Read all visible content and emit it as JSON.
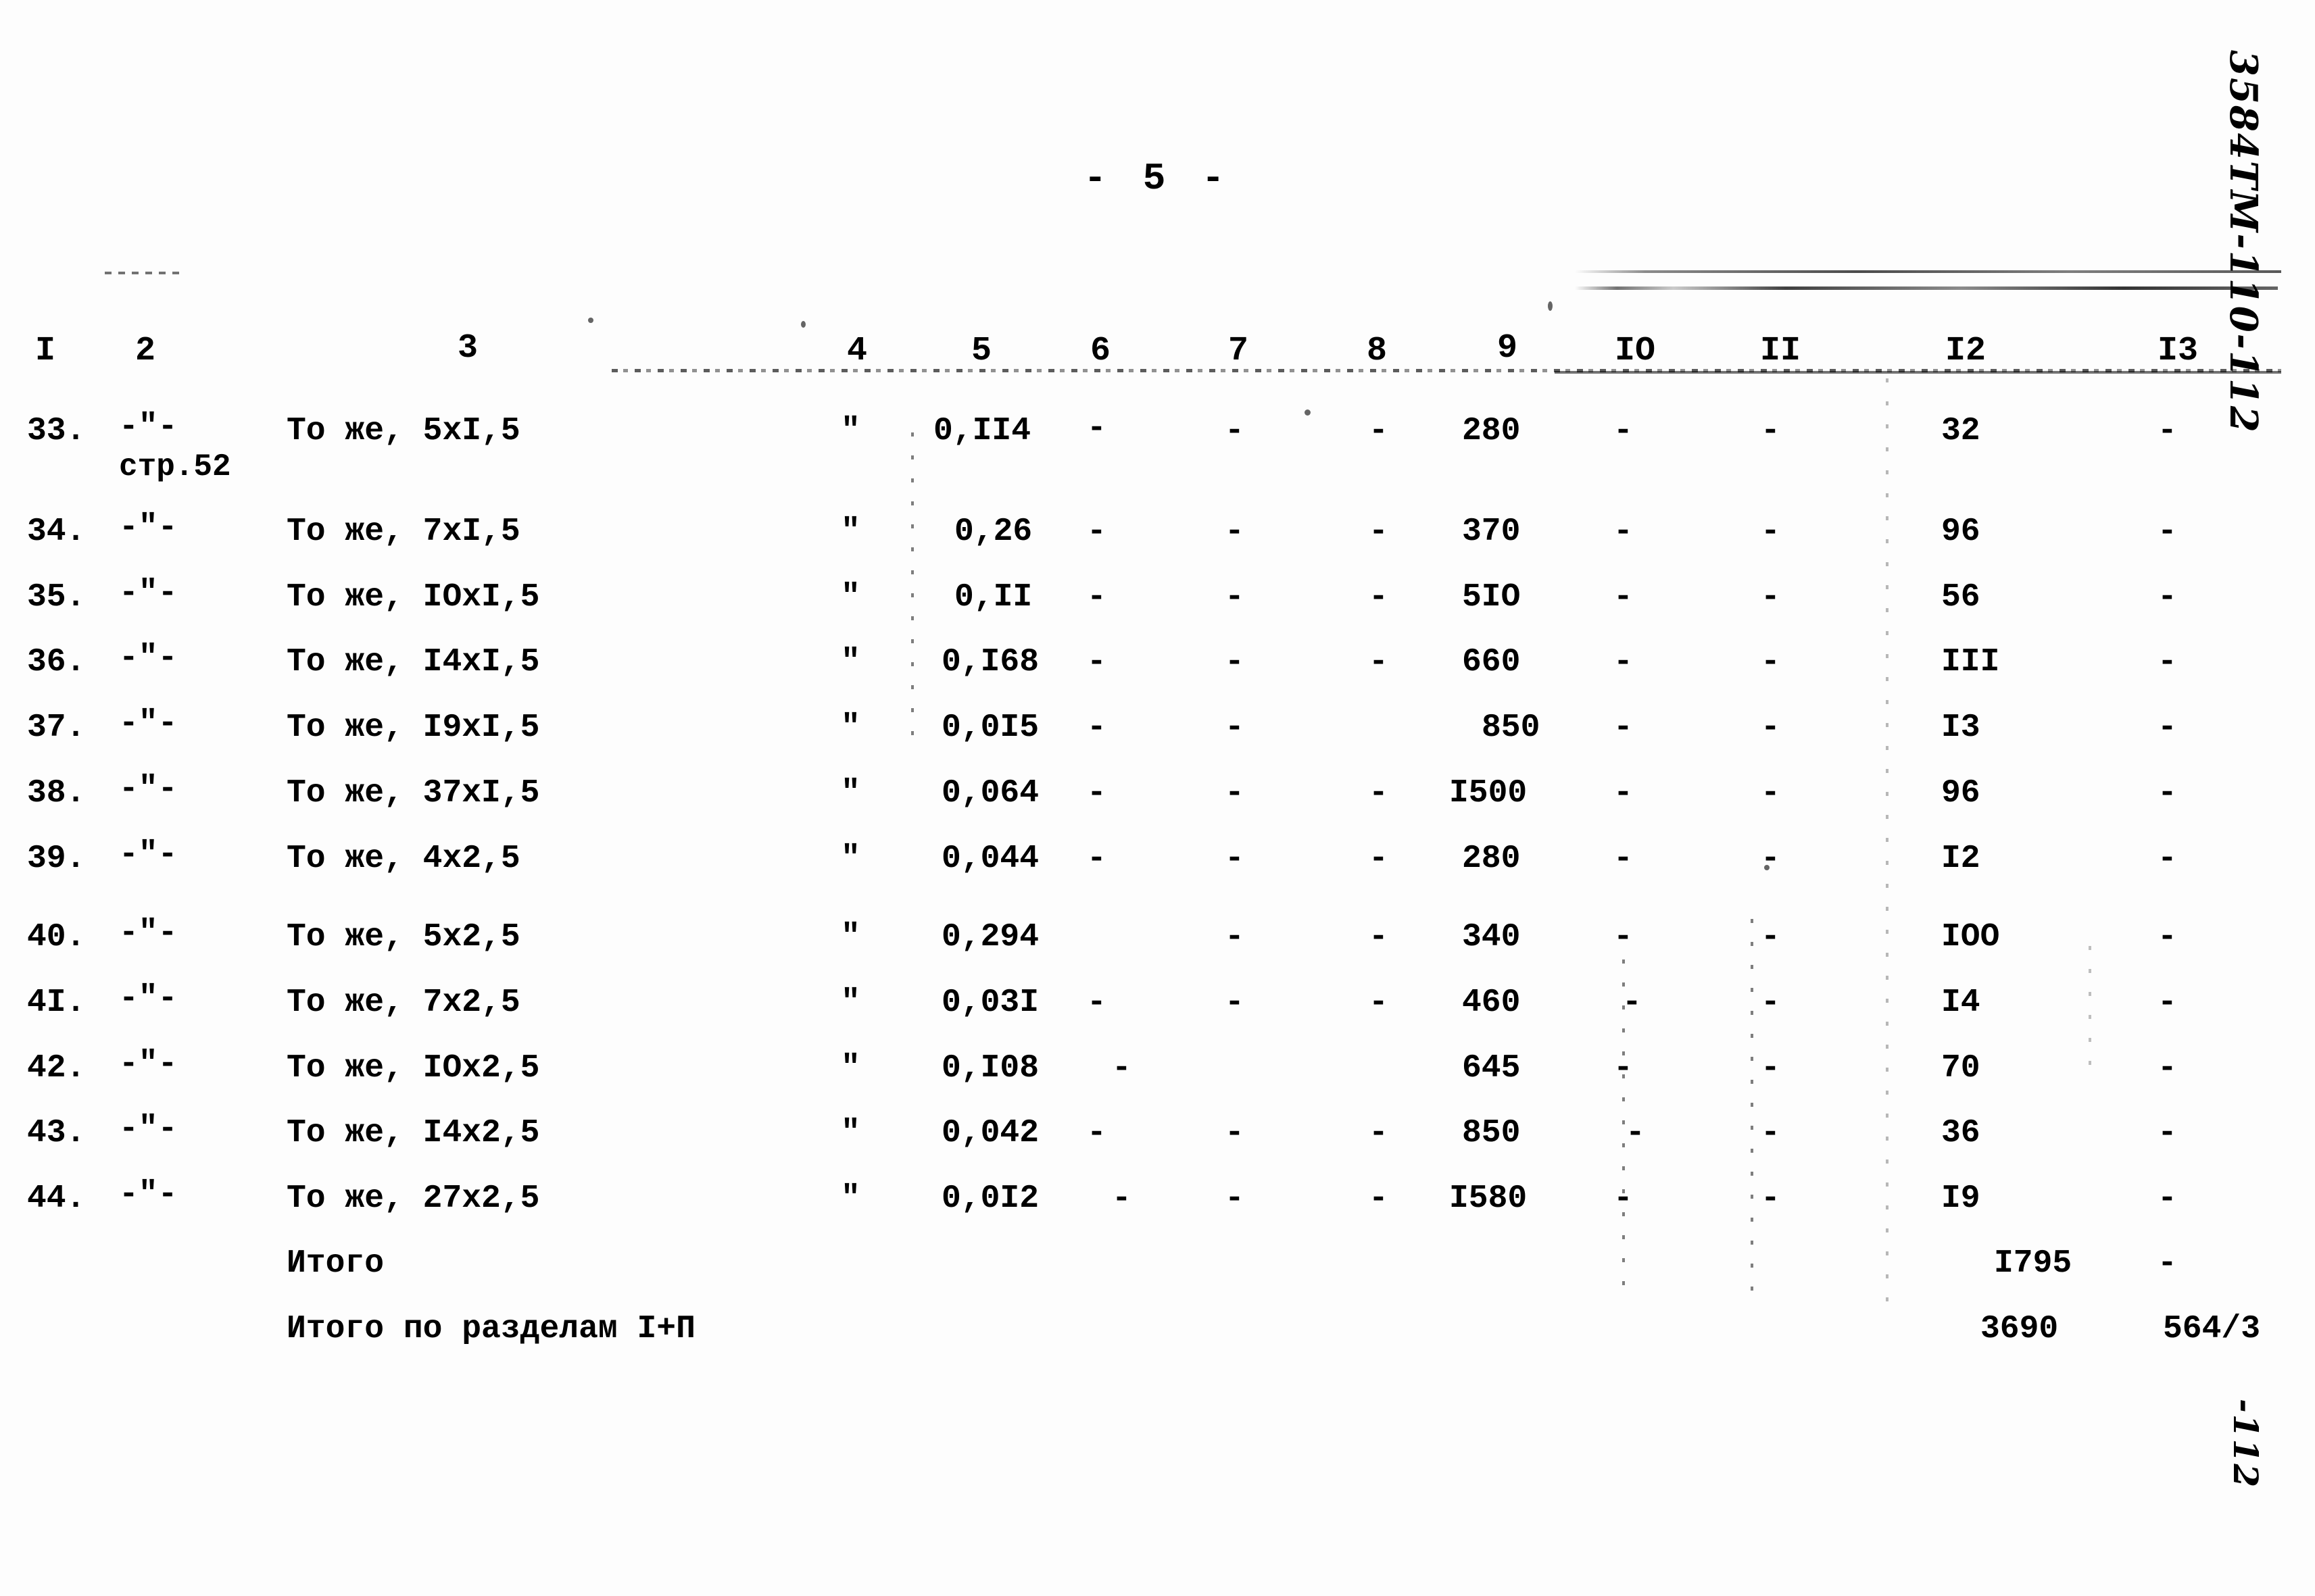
{
  "page": {
    "page_number_label": "- 5 -",
    "margin_note_top": "3584ТМ-110-112",
    "margin_note_bottom": "-112"
  },
  "table": {
    "column_headers": [
      "I",
      "2",
      "3",
      "4",
      "5",
      "6",
      "7",
      "8",
      "9",
      "IO",
      "II",
      "I2",
      "I3"
    ],
    "rows": [
      {
        "c1": "33.",
        "c2": "-\"-",
        "c2b": "стр.52",
        "c3": "То же, 5xI,5",
        "c4": "\"",
        "c5": "0,II4",
        "c6": "-",
        "c7": "-",
        "c8": "-",
        "c9": "280",
        "c10": "-",
        "c11": "-",
        "c12": "32",
        "c13": "-"
      },
      {
        "c1": "34.",
        "c2": "-\"-",
        "c2b": "",
        "c3": "То же, 7xI,5",
        "c4": "\"",
        "c5": "0,26",
        "c6": "-",
        "c7": "-",
        "c8": "-",
        "c9": "370",
        "c10": "-",
        "c11": "-",
        "c12": "96",
        "c13": "-"
      },
      {
        "c1": "35.",
        "c2": "-\"-",
        "c2b": "",
        "c3": "То же, IOxI,5",
        "c4": "\"",
        "c5": "0,II",
        "c6": "-",
        "c7": "-",
        "c8": "-",
        "c9": "5IO",
        "c10": "-",
        "c11": "-",
        "c12": "56",
        "c13": "-"
      },
      {
        "c1": "36.",
        "c2": "-\"-",
        "c2b": "",
        "c3": "То же, I4xI,5",
        "c4": "\"",
        "c5": "0,I68",
        "c6": "-",
        "c7": "-",
        "c8": "-",
        "c9": "660",
        "c10": "-",
        "c11": "-",
        "c12": "III",
        "c13": "-"
      },
      {
        "c1": "37.",
        "c2": "-\"-",
        "c2b": "",
        "c3": "То же, I9xI,5",
        "c4": "\"",
        "c5": "0,0I5",
        "c6": "-",
        "c7": "-",
        "c8": "",
        "c9": "850",
        "c10": "-",
        "c11": "-",
        "c12": "I3",
        "c13": "-"
      },
      {
        "c1": "38.",
        "c2": "-\"-",
        "c2b": "",
        "c3": "То же, 37xI,5",
        "c4": "\"",
        "c5": "0,064",
        "c6": "-",
        "c7": "-",
        "c8": "-",
        "c9": "I500",
        "c10": "-",
        "c11": "-",
        "c12": "96",
        "c13": "-"
      },
      {
        "c1": "39.",
        "c2": "-\"-",
        "c2b": "",
        "c3": "То же, 4x2,5",
        "c4": "\"",
        "c5": "0,044",
        "c6": "-",
        "c7": "-",
        "c8": "-",
        "c9": "280",
        "c10": "-",
        "c11": "-",
        "c12": "I2",
        "c13": "-"
      },
      {
        "c1": "40.",
        "c2": "-\"-",
        "c2b": "",
        "c3": "То же, 5x2,5",
        "c4": "\"",
        "c5": "0,294",
        "c6": "",
        "c7": "-",
        "c8": "-",
        "c9": "340",
        "c10": "-",
        "c11": "-",
        "c12": "IOO",
        "c13": "-"
      },
      {
        "c1": "4I.",
        "c2": "-\"-",
        "c2b": "",
        "c3": "То же, 7x2,5",
        "c4": "\"",
        "c5": "0,03I",
        "c6": "-",
        "c7": "-",
        "c8": "-",
        "c9": "460",
        "c10": "-",
        "c11": "-",
        "c12": "I4",
        "c13": "-"
      },
      {
        "c1": "42.",
        "c2": "-\"-",
        "c2b": "",
        "c3": "То же, IOx2,5",
        "c4": "\"",
        "c5": "0,I08",
        "c6": "-",
        "c7": "",
        "c8": "",
        "c9": "645",
        "c10": "-",
        "c11": "-",
        "c12": "70",
        "c13": "-"
      },
      {
        "c1": "43.",
        "c2": "-\"-",
        "c2b": "",
        "c3": "То же, I4x2,5",
        "c4": "\"",
        "c5": "0,042",
        "c6": "-",
        "c7": "-",
        "c8": "-",
        "c9": "850",
        "c10": "-",
        "c11": "-",
        "c12": "36",
        "c13": "-"
      },
      {
        "c1": "44.",
        "c2": "-\"-",
        "c2b": "",
        "c3": "То же, 27x2,5",
        "c4": "\"",
        "c5": "0,0I2",
        "c6": "-",
        "c7": "-",
        "c8": "-",
        "c9": "I580",
        "c10": "-",
        "c11": "-",
        "c12": "I9",
        "c13": "-"
      }
    ],
    "totals": [
      {
        "c1": "",
        "c2": "",
        "c3": "Итого",
        "c4": "",
        "c5": "",
        "c6": "",
        "c7": "",
        "c8": "",
        "c9": "",
        "c10": "",
        "c11": "",
        "c12": "I795",
        "c13": "-"
      },
      {
        "c1": "",
        "c2": "",
        "c3": "Итого по разделам I+П",
        "c4": "",
        "c5": "",
        "c6": "",
        "c7": "",
        "c8": "",
        "c9": "",
        "c10": "",
        "c11": "",
        "c12": "3690",
        "c13": "564/3"
      }
    ]
  }
}
